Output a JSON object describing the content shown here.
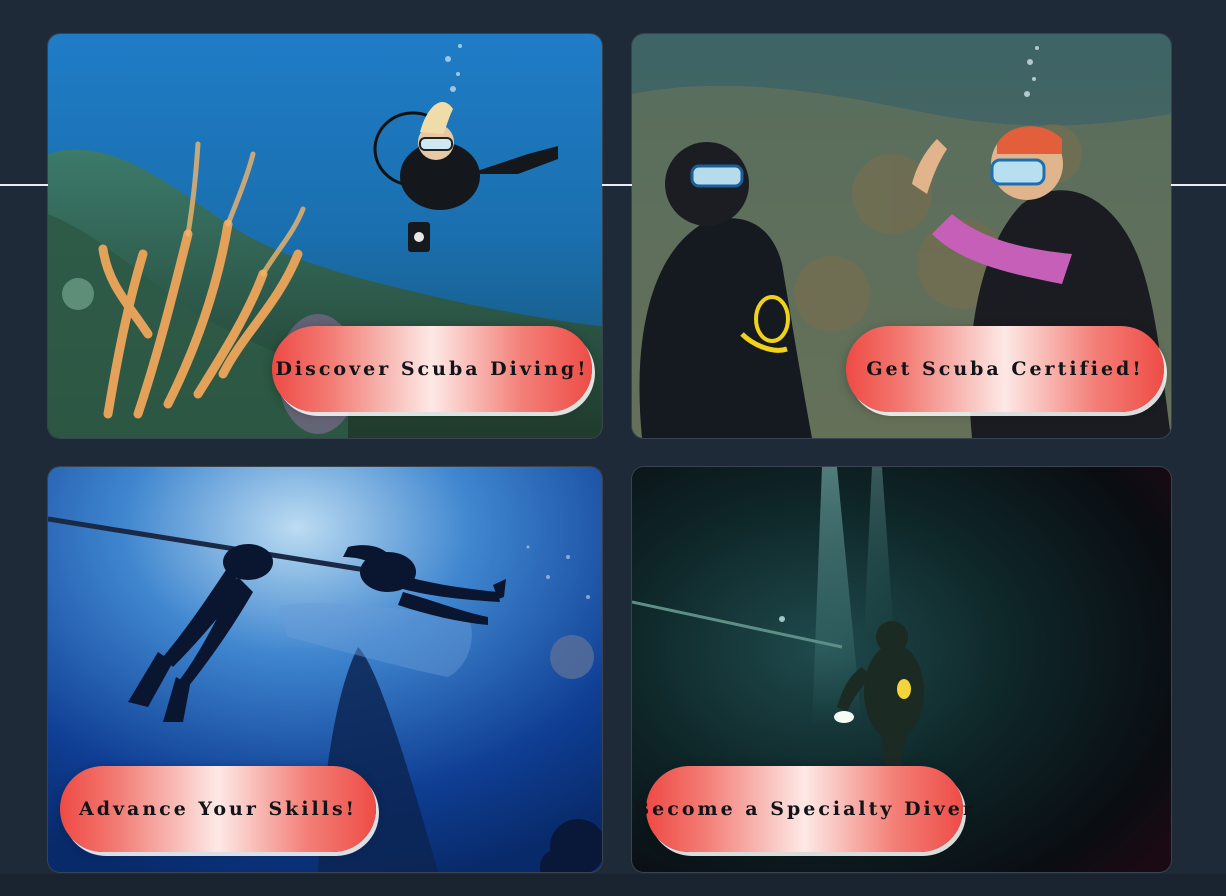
{
  "page": {
    "background": "#1f2a38"
  },
  "cards": [
    {
      "id": "discover",
      "image": "diver-over-coral-reef-photo",
      "button_label": "Discover Scuba Diving!"
    },
    {
      "id": "certified",
      "image": "divers-training-on-seafloor-photo",
      "button_label": "Get Scuba Certified!"
    },
    {
      "id": "advance",
      "image": "divers-silhouette-under-boat-photo",
      "button_label": "Advance Your Skills!"
    },
    {
      "id": "specialty",
      "image": "night-diver-with-torch-photo",
      "button_label": "Become a Specialty Diver"
    }
  ],
  "colors": {
    "button_red": "#ef4a45",
    "button_center": "#fde9e6",
    "divider": "#e9edf2"
  }
}
